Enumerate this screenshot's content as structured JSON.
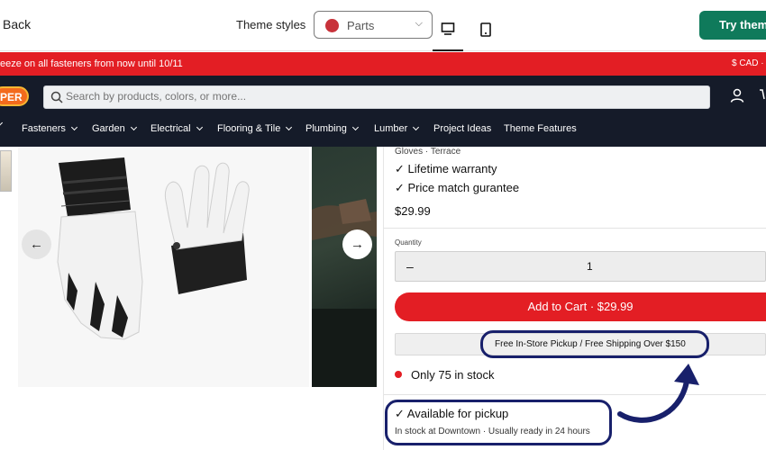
{
  "editor": {
    "back_label": "Back",
    "theme_styles_label": "Theme styles",
    "style_select_value": "Parts",
    "try_theme_label": "Try theme",
    "accent_color": "#0f7a5b"
  },
  "announcement": {
    "text": "eeze on all fasteners from now until 10/11",
    "currency": "$ CAD · En"
  },
  "header": {
    "logo_text": "PER",
    "search_placeholder": "Search by products, colors, or more...",
    "nav": [
      "Fasteners",
      "Garden",
      "Electrical",
      "Flooring & Tile",
      "Plumbing",
      "Lumber",
      "Project Ideas",
      "Theme Features"
    ]
  },
  "product": {
    "vendor": "Gloves · Terrace",
    "features": [
      "✓ Lifetime warranty",
      "✓ Price match gurantee"
    ],
    "price": "$29.99",
    "quantity_label": "Quantity",
    "quantity_minus": "–",
    "quantity_value": "1",
    "add_to_cart": "Add to Cart · $29.99",
    "pickup_banner": "Free In-Store Pickup / Free Shipping Over $150",
    "stock_text": "Only 75 in stock",
    "availability_title": "✓ Available for pickup",
    "availability_sub": "In stock at Downtown · Usually ready in 24 hours"
  },
  "gallery": {
    "prev_arrow": "←",
    "next_arrow": "→"
  },
  "colors": {
    "brand_red": "#e31e24",
    "header_dark": "#151b29",
    "annotation_navy": "#18206b"
  }
}
